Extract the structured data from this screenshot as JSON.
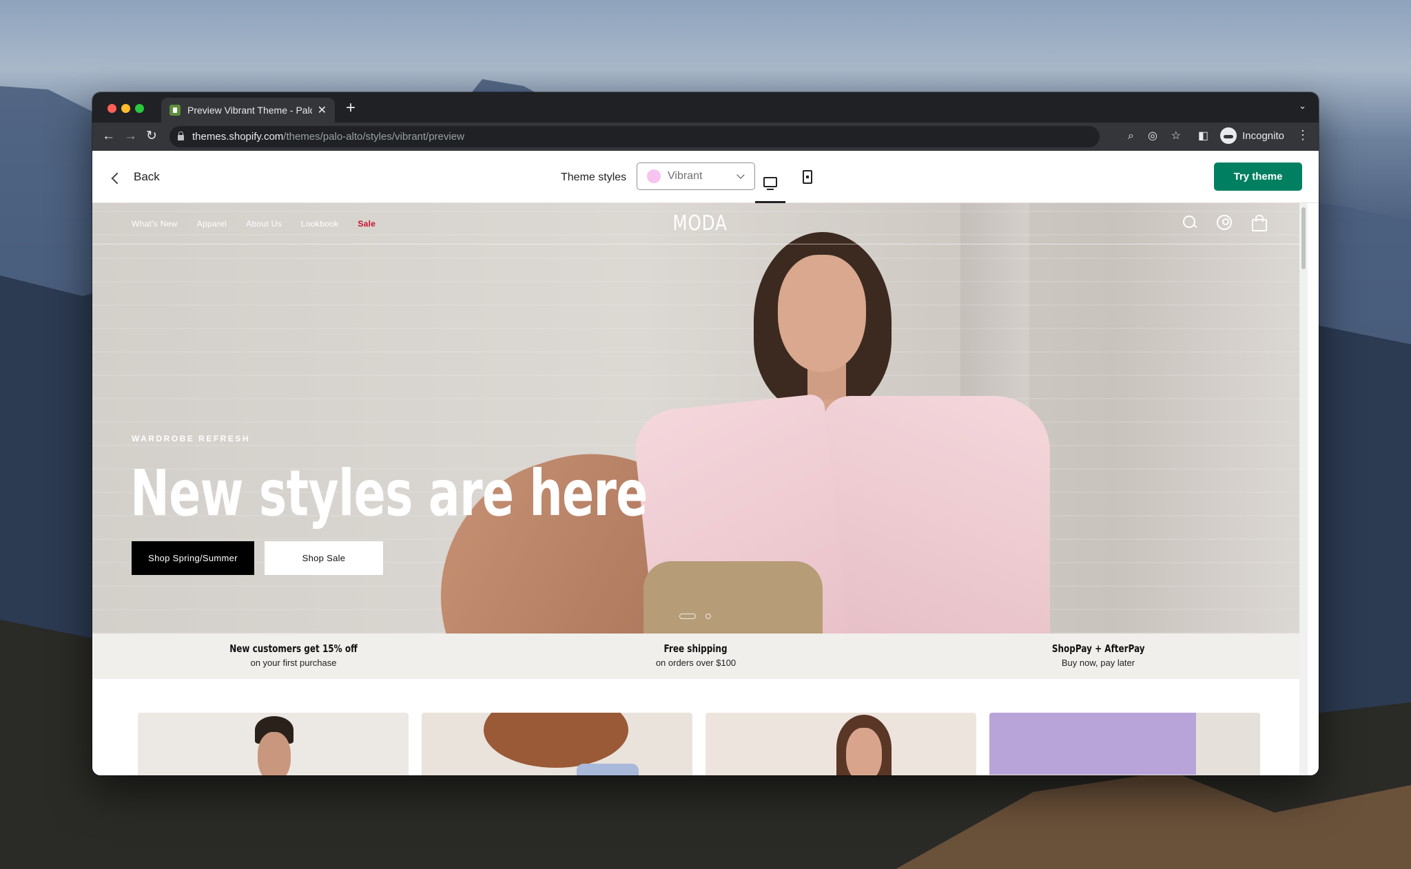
{
  "browser": {
    "tab_title": "Preview Vibrant Theme - Palo Alto",
    "new_tab_label": "+",
    "url_host": "themes.shopify.com",
    "url_path": "/themes/palo-alto/styles/vibrant/preview",
    "profile_label": "Incognito"
  },
  "preview_bar": {
    "back_label": "Back",
    "theme_styles_label": "Theme styles",
    "selected_style": "Vibrant",
    "selected_style_color": "#f7c3f0",
    "try_theme_label": "Try theme",
    "accent_color": "#008060"
  },
  "store": {
    "nav_links": [
      "What's New",
      "Apparel",
      "About Us",
      "Lookbook",
      "Sale"
    ],
    "logo": "MODA",
    "hero": {
      "eyebrow": "WARDROBE REFRESH",
      "headline": "New styles are here",
      "primary_button": "Shop Spring/Summer",
      "secondary_button": "Shop Sale",
      "slide_count": 2,
      "active_slide": 1
    },
    "promos": [
      {
        "title": "New customers get 15% off",
        "subtitle": "on your first purchase"
      },
      {
        "title": "Free shipping",
        "subtitle": "on orders over $100"
      },
      {
        "title": "ShopPay + AfterPay",
        "subtitle": "Buy now, pay later"
      }
    ],
    "sale_color": "#c8102e"
  }
}
